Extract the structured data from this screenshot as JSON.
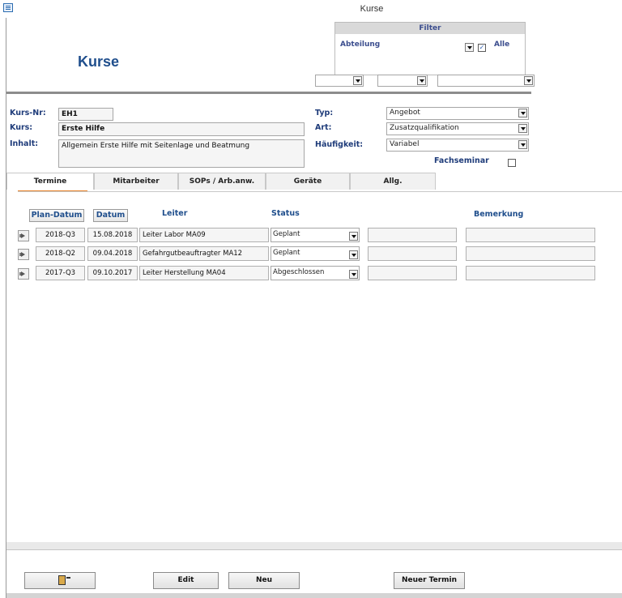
{
  "window": {
    "title": "Kurse",
    "icon": "form-icon"
  },
  "header": {
    "title": "Kurse"
  },
  "filter": {
    "title": "Filter",
    "abteilung_label": "Abteilung",
    "alle_label": "Alle",
    "alle_checked": true,
    "combos": [
      "",
      "",
      ""
    ]
  },
  "form": {
    "kursnr_label": "Kurs-Nr:",
    "kursnr": "EH1",
    "kurs_label": "Kurs:",
    "kurs": "Erste Hilfe",
    "inhalt_label": "Inhalt:",
    "inhalt": "Allgemein Erste Hilfe mit Seitenlage und Beatmung",
    "typ_label": "Typ:",
    "typ": "Angebot",
    "art_label": "Art:",
    "art": "Zusatzqualifikation",
    "haeufigkeit_label": "Häufigkeit:",
    "haeufigkeit": "Variabel",
    "fachseminar_label": "Fachseminar",
    "fachseminar_checked": false
  },
  "tabs": [
    {
      "label": "Termine",
      "active": true
    },
    {
      "label": "Mitarbeiter"
    },
    {
      "label": "SOPs / Arb.anw."
    },
    {
      "label": "Geräte"
    },
    {
      "label": "Allg."
    }
  ],
  "table": {
    "headers": {
      "plan_datum": "Plan-Datum",
      "datum": "Datum",
      "leiter": "Leiter",
      "status": "Status",
      "bemerkung": "Bemerkung"
    },
    "rows": [
      {
        "plan": "2018-Q3",
        "datum": "15.08.2018",
        "leiter": "Leiter Labor MA09",
        "status": "Geplant",
        "extra": "",
        "bemerkung": ""
      },
      {
        "plan": "2018-Q2",
        "datum": "09.04.2018",
        "leiter": "Gefahrgutbeauftragter MA12",
        "status": "Geplant",
        "extra": "",
        "bemerkung": ""
      },
      {
        "plan": "2017-Q3",
        "datum": "09.10.2017",
        "leiter": "Leiter Herstellung MA04",
        "status": "Abgeschlossen",
        "extra": "",
        "bemerkung": ""
      }
    ]
  },
  "footer": {
    "exit_icon": "exit-door-icon",
    "edit": "Edit",
    "neu": "Neu",
    "neuer_termin": "Neuer Termin"
  }
}
